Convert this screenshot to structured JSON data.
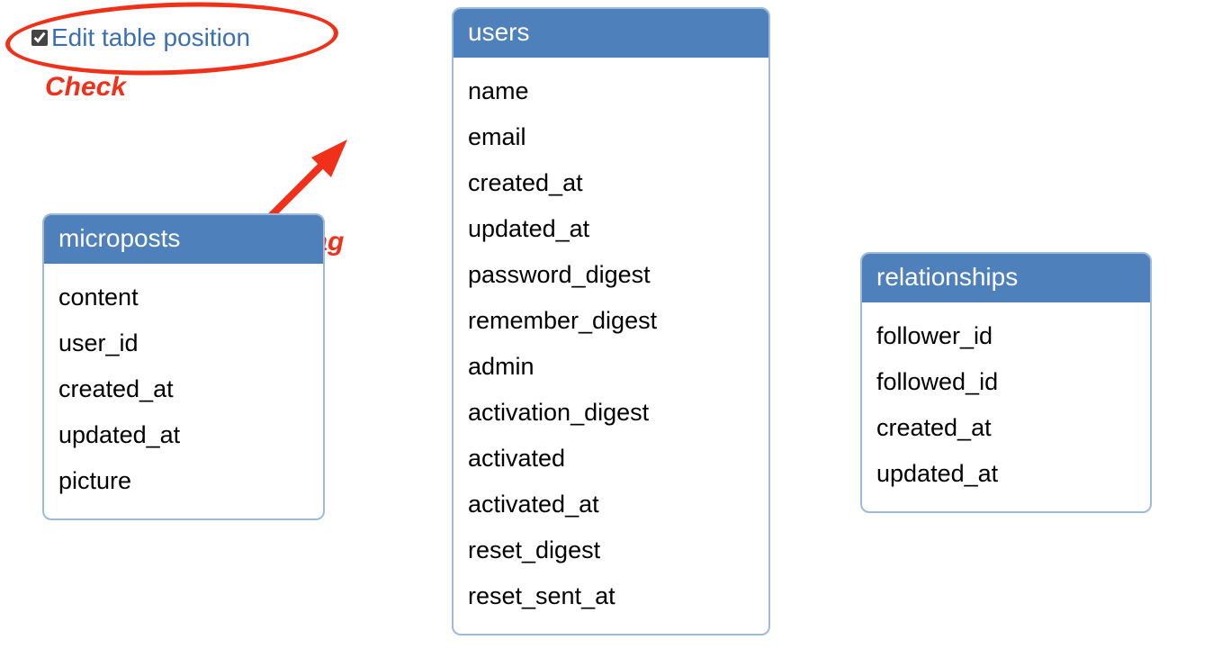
{
  "toggle": {
    "label": "Edit table position",
    "checked": true
  },
  "annotations": {
    "check": "Check",
    "drag": "Drag"
  },
  "tables": {
    "microposts": {
      "title": "microposts",
      "columns": [
        "content",
        "user_id",
        "created_at",
        "updated_at",
        "picture"
      ]
    },
    "users": {
      "title": "users",
      "columns": [
        "name",
        "email",
        "created_at",
        "updated_at",
        "password_digest",
        "remember_digest",
        "admin",
        "activation_digest",
        "activated",
        "activated_at",
        "reset_digest",
        "reset_sent_at"
      ]
    },
    "relationships": {
      "title": "relationships",
      "columns": [
        "follower_id",
        "followed_id",
        "created_at",
        "updated_at"
      ]
    }
  },
  "colors": {
    "header_bg": "#4e80bb",
    "border": "#9dbbd8",
    "link": "#3a6fb5",
    "annotation": "#f03018"
  }
}
